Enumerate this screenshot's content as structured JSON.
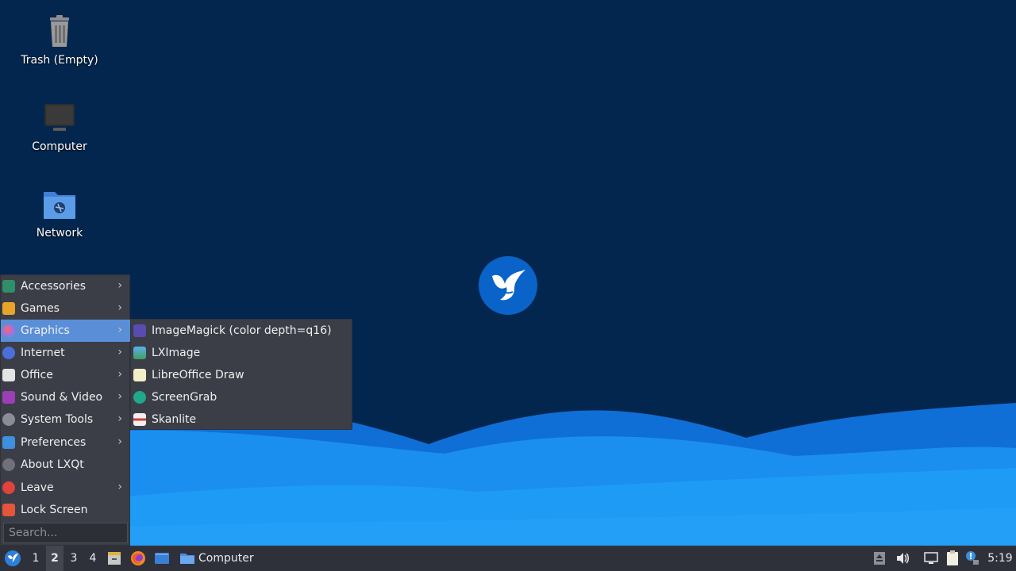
{
  "desktop": {
    "icons": [
      {
        "label": "Trash (Empty)",
        "icon": "trash-icon"
      },
      {
        "label": "Computer",
        "icon": "computer-icon"
      },
      {
        "label": "Network",
        "icon": "network-folder-icon"
      }
    ]
  },
  "menu": {
    "items": [
      {
        "label": "Accessories",
        "icon": "accessories-icon",
        "submenu": true
      },
      {
        "label": "Games",
        "icon": "games-icon",
        "submenu": true
      },
      {
        "label": "Graphics",
        "icon": "graphics-icon",
        "submenu": true,
        "active": true
      },
      {
        "label": "Internet",
        "icon": "internet-icon",
        "submenu": true
      },
      {
        "label": "Office",
        "icon": "office-icon",
        "submenu": true
      },
      {
        "label": "Sound & Video",
        "icon": "sound-video-icon",
        "submenu": true
      },
      {
        "label": "System Tools",
        "icon": "system-tools-icon",
        "submenu": true
      },
      {
        "label": "Preferences",
        "icon": "preferences-icon",
        "submenu": true
      },
      {
        "label": "About LXQt",
        "icon": "about-icon",
        "submenu": false
      },
      {
        "label": "Leave",
        "icon": "leave-icon",
        "submenu": true
      },
      {
        "label": "Lock Screen",
        "icon": "lock-icon",
        "submenu": false
      }
    ],
    "search_placeholder": "Search..."
  },
  "submenu": {
    "items": [
      {
        "label": "ImageMagick (color depth=q16)",
        "icon": "imagemagick-icon"
      },
      {
        "label": "LXImage",
        "icon": "lximage-icon"
      },
      {
        "label": "LibreOffice Draw",
        "icon": "libreoffice-draw-icon"
      },
      {
        "label": "ScreenGrab",
        "icon": "screengrab-icon"
      },
      {
        "label": "Skanlite",
        "icon": "skanlite-icon"
      }
    ]
  },
  "taskbar": {
    "desktops": [
      "1",
      "2",
      "3",
      "4"
    ],
    "active_desktop": "2",
    "window_title": "Computer",
    "clock": "5:19"
  },
  "colors": {
    "wallpaper_dark": "#03264f",
    "wave_blue": "#1a8ff0",
    "menu_bg": "#3b3d47",
    "highlight": "#5a8fd8"
  }
}
